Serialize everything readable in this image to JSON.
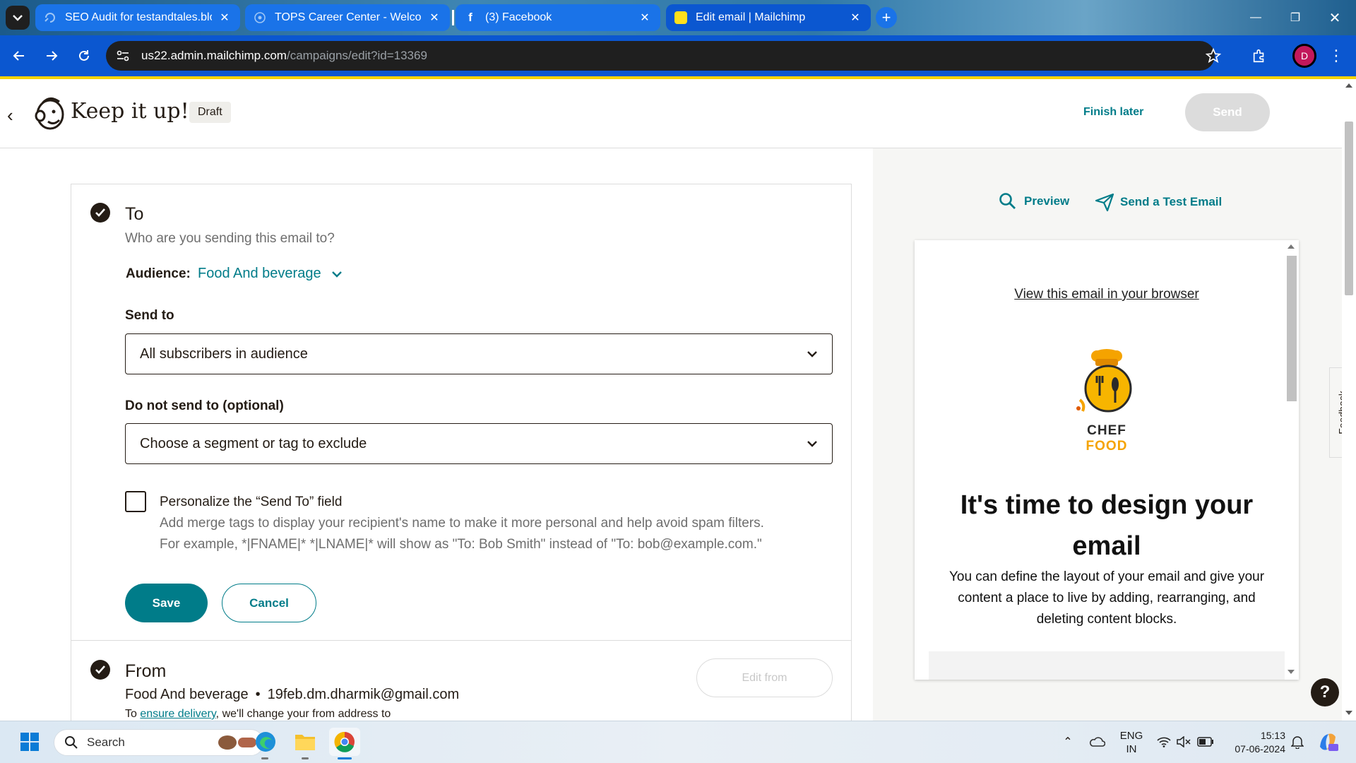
{
  "browser": {
    "tabs": [
      {
        "title": "SEO Audit for testandtales.blog",
        "icon": "seo-tool-icon"
      },
      {
        "title": "TOPS Career Center - Welcome",
        "icon": "tops-icon"
      },
      {
        "title": "(3) Facebook",
        "icon": "facebook-icon"
      },
      {
        "title": "Edit email | Mailchimp",
        "icon": "mailchimp-icon",
        "active": true
      }
    ],
    "url_host": "us22.admin.mailchimp.com",
    "url_path": "/campaigns/edit?id=13369",
    "profile_initial": "D"
  },
  "header": {
    "title": "Keep it up!",
    "status_badge": "Draft",
    "finish_later": "Finish later",
    "send": "Send"
  },
  "to_section": {
    "heading": "To",
    "subheading": "Who are you sending this email to?",
    "audience_label": "Audience:",
    "audience_value": "Food And beverage",
    "send_to_label": "Send to",
    "send_to_value": "All subscribers in audience",
    "exclude_label": "Do not send to (optional)",
    "exclude_placeholder": "Choose a segment or tag to exclude",
    "personalize_label": "Personalize the “Send To” field",
    "personalize_help_1": "Add merge tags to display your recipient's name to make it more personal and help avoid spam filters.",
    "personalize_help_2": "For example, *|FNAME|* *|LNAME|* will show as \"To: Bob Smith\" instead of \"To: bob@example.com.\"",
    "personalize_checked": false,
    "save": "Save",
    "cancel": "Cancel"
  },
  "from_section": {
    "heading": "From",
    "sender_name": "Food And beverage",
    "separator": "•",
    "sender_email": "19feb.dm.dharmik@gmail.com",
    "note_prefix": "To",
    "note_link": "ensure delivery",
    "note_suffix": ", we'll change your from address to",
    "edit_button": "Edit from"
  },
  "preview_panel": {
    "preview": "Preview",
    "send_test": "Send a Test Email",
    "browser_link": "View this email in your browser",
    "logo_text_1": "CHEF",
    "logo_text_2": "FOOD",
    "headline": "It's time to design your email",
    "body": "You can define the layout of your email and give your content a place to live by adding, rearranging, and deleting content blocks.",
    "feedback": "Feedback",
    "help": "?"
  },
  "taskbar": {
    "search_placeholder": "Search",
    "lang_1": "ENG",
    "lang_2": "IN",
    "time": "15:13",
    "date": "07-06-2024"
  },
  "colors": {
    "accent": "#007c89",
    "chrome_blue": "#0b57d0",
    "ink": "#241c15",
    "chef_orange": "#f5a300"
  }
}
